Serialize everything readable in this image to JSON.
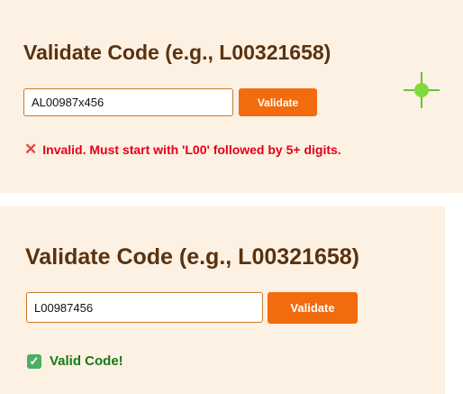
{
  "panels": [
    {
      "title": "Validate Code (e.g., L00321658)",
      "input_value": "AL00987x456",
      "button_label": "Validate",
      "message": "Invalid. Must start with 'L00' followed by 5+ digits.",
      "status": "invalid",
      "status_icon": "x-mark-icon"
    },
    {
      "title": "Validate Code (e.g., L00321658)",
      "input_value": "L00987456",
      "button_label": "Validate",
      "message": "Valid Code!",
      "status": "valid",
      "status_icon": "check-icon"
    }
  ],
  "colors": {
    "panel_background": "#fdf1e3",
    "title": "#5a3210",
    "button": "#f26b0c",
    "error": "#e3001b",
    "success": "#157a15",
    "cursor_marker": "#7ddc3c"
  },
  "cursor_marker": "crosshair-cursor-icon"
}
